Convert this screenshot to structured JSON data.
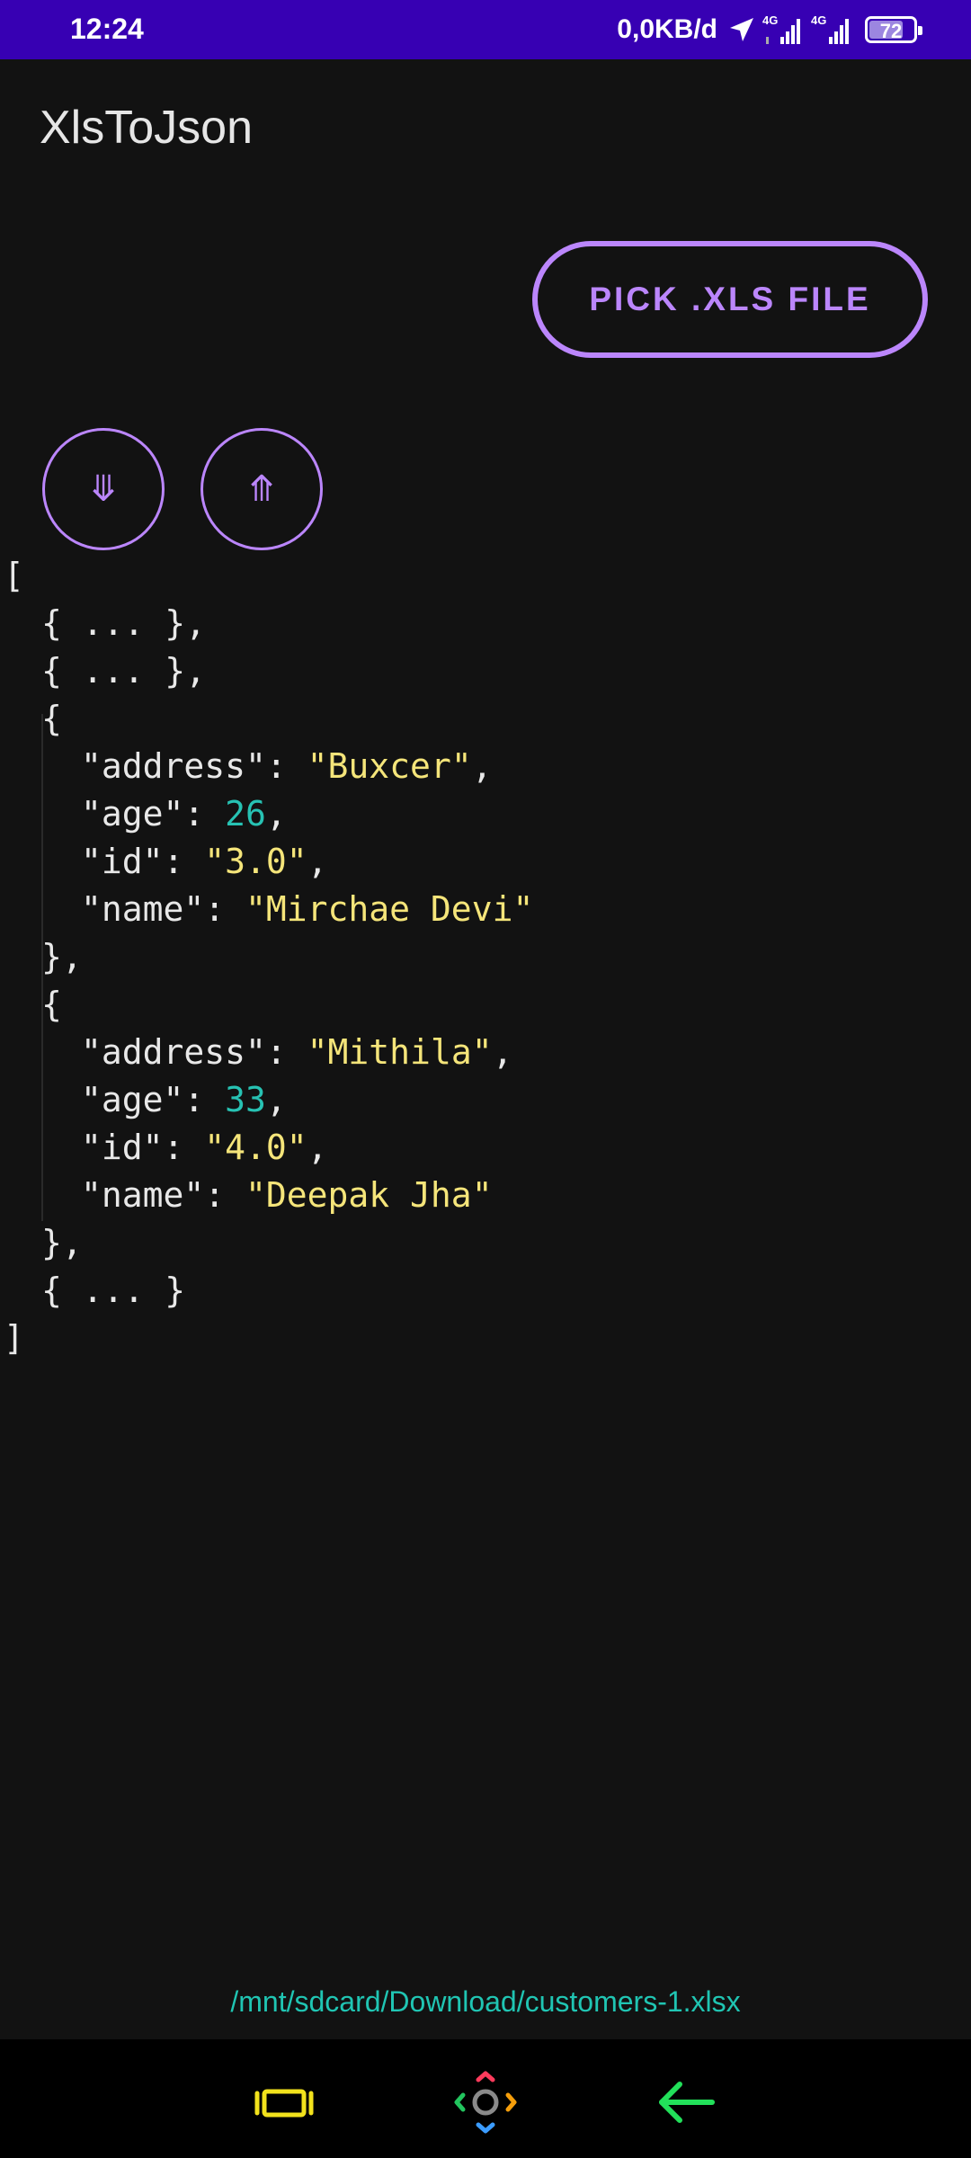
{
  "status_bar": {
    "time": "12:24",
    "net_speed": "0,0KB/d",
    "network_type_1": "4G",
    "network_type_2": "4G",
    "battery_level": "72"
  },
  "app_bar": {
    "title": "XlsToJson"
  },
  "actions": {
    "pick_label": "PICK .XLS FILE",
    "expand_icon": "⤋",
    "collapse_icon": "⤊"
  },
  "json_view": {
    "open_bracket": "[",
    "collapsed_item_1": "{ ... },",
    "collapsed_item_2": "{ ... },",
    "record_3_open": "{",
    "record_3": {
      "address_key": "\"address\": ",
      "address_value": "\"Buxcer\"",
      "age_key": "\"age\": ",
      "age_value": "26",
      "id_key": "\"id\": ",
      "id_value": "\"3.0\"",
      "name_key": "\"name\": ",
      "name_value": "\"Mirchae Devi\""
    },
    "record_3_close": "},",
    "record_4_open": "{",
    "record_4": {
      "address_key": "\"address\": ",
      "address_value": "\"Mithila\"",
      "age_key": "\"age\": ",
      "age_value": "33",
      "id_key": "\"id\": ",
      "id_value": "\"4.0\"",
      "name_key": "\"name\": ",
      "name_value": "\"Deepak Jha\""
    },
    "record_4_close": "},",
    "collapsed_item_5": "{ ... }",
    "close_bracket": "]",
    "comma": ","
  },
  "file_path": "/mnt/sdcard/Download/customers-1.xlsx",
  "colors": {
    "status_bar": "#3700b3",
    "background": "#121212",
    "accent": "#bb86fc",
    "string": "#f5e57a",
    "number": "#27c2b3",
    "path": "#20c5b3"
  },
  "nav_bar": {
    "recents_icon": "recents-icon",
    "home_icon": "home-icon",
    "back_icon": "back-icon"
  }
}
